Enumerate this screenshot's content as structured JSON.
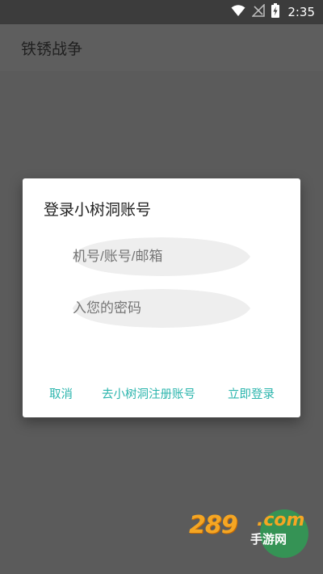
{
  "status_bar": {
    "time": "2:35",
    "icons": [
      "wifi-icon",
      "no-signal-icon",
      "battery-charging-icon"
    ]
  },
  "app_bar": {
    "title": "铁锈战争"
  },
  "dialog": {
    "title": "登录小树洞账号",
    "account_field": {
      "placeholder": "机号/账号/邮箱",
      "visible_text": "机号/账号/邮箱"
    },
    "password_field": {
      "placeholder": "入您的密码",
      "visible_text": "入您的密码"
    },
    "buttons": {
      "cancel": "取消",
      "register": "去小树洞注册账号",
      "login": "立即登录"
    }
  },
  "watermark": {
    "logo": "289",
    "com": ".com",
    "subtitle": "手游网"
  },
  "colors": {
    "accent": "#2bb5ad",
    "background": "#5b5b5b",
    "status_bar": "#3c3c3c",
    "dialog": "#ffffff",
    "field": "#eeeeee"
  }
}
